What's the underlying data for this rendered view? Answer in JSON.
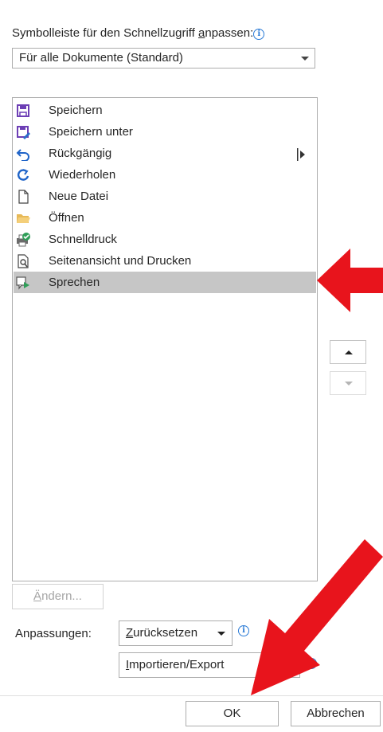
{
  "header": {
    "label_prefix": "Symbolleiste für den Schnellzugriff ",
    "label_accel": "a",
    "label_suffix": "npassen:",
    "info_icon": "i"
  },
  "scope_select": {
    "selected": "Für alle Dokumente (Standard)"
  },
  "list": {
    "items": [
      {
        "label": "Speichern",
        "icon": "save-icon"
      },
      {
        "label": "Speichern unter",
        "icon": "save-as-icon"
      },
      {
        "label": "Rückgängig",
        "icon": "undo-icon"
      },
      {
        "label": "Wiederholen",
        "icon": "redo-icon"
      },
      {
        "label": "Neue Datei",
        "icon": "new-file-icon"
      },
      {
        "label": "Öffnen",
        "icon": "folder-open-icon"
      },
      {
        "label": "Schnelldruck",
        "icon": "quick-print-icon"
      },
      {
        "label": "Seitenansicht und Drucken",
        "icon": "print-preview-icon"
      },
      {
        "label": "Sprechen",
        "icon": "speak-icon",
        "selected": true
      }
    ]
  },
  "modify": {
    "label_accel": "Ä",
    "label_rest": "ndern..."
  },
  "customizations": {
    "label": "Anpassungen:",
    "reset_accel": "Z",
    "reset_rest": "urücksetzen",
    "import_accel": "I",
    "import_rest": "mportieren/Export"
  },
  "footer": {
    "ok": "OK",
    "cancel": "Abbrechen"
  },
  "colors": {
    "annotation_arrow": "#e8141c",
    "selection": "#c6c6c6",
    "info": "#2b7bd6"
  }
}
